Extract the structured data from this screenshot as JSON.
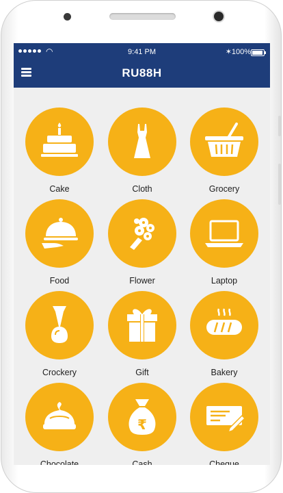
{
  "status_bar": {
    "time": "9:41 PM",
    "battery": "100%"
  },
  "header": {
    "logo": "RU88H"
  },
  "categories": [
    {
      "label": "Cake",
      "icon": "cake-icon"
    },
    {
      "label": "Cloth",
      "icon": "dress-icon"
    },
    {
      "label": "Grocery",
      "icon": "basket-icon"
    },
    {
      "label": "Food",
      "icon": "food-cloche-icon"
    },
    {
      "label": "Flower",
      "icon": "flower-bouquet-icon"
    },
    {
      "label": "Laptop",
      "icon": "laptop-icon"
    },
    {
      "label": "Crockery",
      "icon": "vase-icon"
    },
    {
      "label": "Gift",
      "icon": "gift-box-icon"
    },
    {
      "label": "Bakery",
      "icon": "bread-icon"
    },
    {
      "label": "Chocolate",
      "icon": "chocolate-icon"
    },
    {
      "label": "Cash",
      "icon": "money-bag-icon"
    },
    {
      "label": "Cheque",
      "icon": "cheque-icon"
    }
  ],
  "colors": {
    "accent": "#f6b117",
    "navbar": "#1e3d7a",
    "background": "#efefef"
  }
}
